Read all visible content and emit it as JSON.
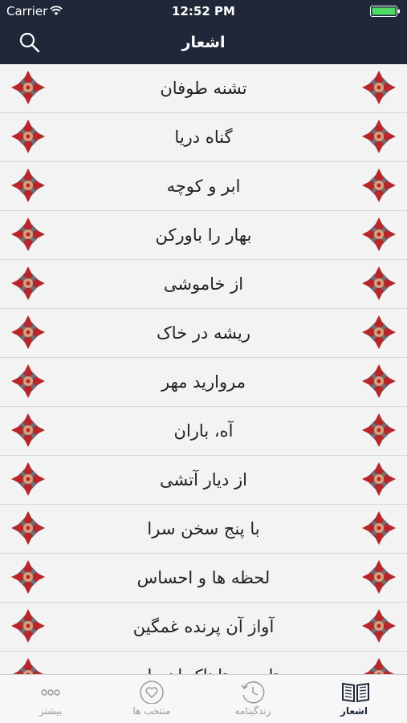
{
  "status_bar": {
    "carrier": "Carrier",
    "time": "12:52 PM"
  },
  "header": {
    "title": "اشعار"
  },
  "poems": [
    "تشنه طوفان",
    "گناه دریا",
    "ابر و کوچه",
    "بهار را باورکن",
    "از خاموشی",
    "ریشه در خاک",
    "مروارید مهر",
    "آه، باران",
    "از دیار آتشی",
    "با پنج سخن سرا",
    "لحظه ها و احساس",
    "آواز آن پرنده غمگین",
    "تا صبح تابناک اهورایی"
  ],
  "tabs": [
    {
      "label": "بیشتر",
      "icon": "more-icon",
      "active": false
    },
    {
      "label": "منتخب ها",
      "icon": "heart-icon",
      "active": false
    },
    {
      "label": "زندگینامه",
      "icon": "history-clock-icon",
      "active": false
    },
    {
      "label": "اشعار",
      "icon": "open-book-icon",
      "active": true
    }
  ],
  "colors": {
    "header_bg": "#1f2838",
    "row_bg": "#f3f3f3",
    "ornament_red": "#b5272a",
    "ornament_grey": "#6f6f78",
    "battery": "#4cd964"
  }
}
